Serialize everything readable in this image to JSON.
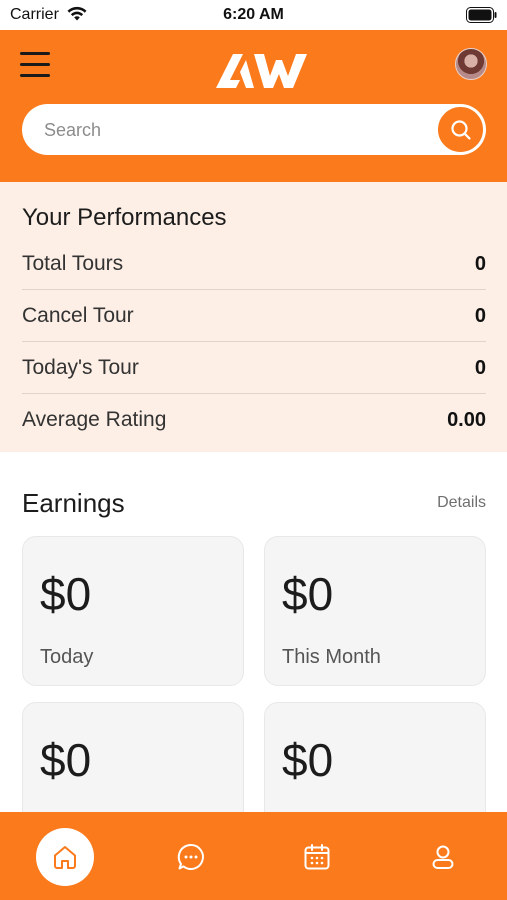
{
  "status_bar": {
    "carrier": "Carrier",
    "time": "6:20 AM"
  },
  "header": {
    "logo_alt": "AW",
    "search": {
      "placeholder": "Search",
      "value": ""
    }
  },
  "performance": {
    "title": "Your Performances",
    "rows": [
      {
        "label": "Total Tours",
        "value": "0"
      },
      {
        "label": "Cancel Tour",
        "value": "0"
      },
      {
        "label": "Today's Tour",
        "value": "0"
      },
      {
        "label": "Average Rating",
        "value": "0.00"
      }
    ]
  },
  "earnings": {
    "title": "Earnings",
    "details_label": "Details",
    "cards": [
      {
        "amount": "$0",
        "caption": "Today"
      },
      {
        "amount": "$0",
        "caption": "This Month"
      },
      {
        "amount": "$0",
        "caption": ""
      },
      {
        "amount": "$0",
        "caption": ""
      }
    ]
  },
  "bottom_nav": {
    "items": [
      {
        "icon": "home-icon",
        "active": true
      },
      {
        "icon": "chat-icon",
        "active": false
      },
      {
        "icon": "calendar-icon",
        "active": false
      },
      {
        "icon": "profile-icon",
        "active": false
      }
    ]
  },
  "colors": {
    "brand": "#fb7a1c",
    "performance_bg": "#fdefe6",
    "card_bg": "#f5f5f5"
  }
}
